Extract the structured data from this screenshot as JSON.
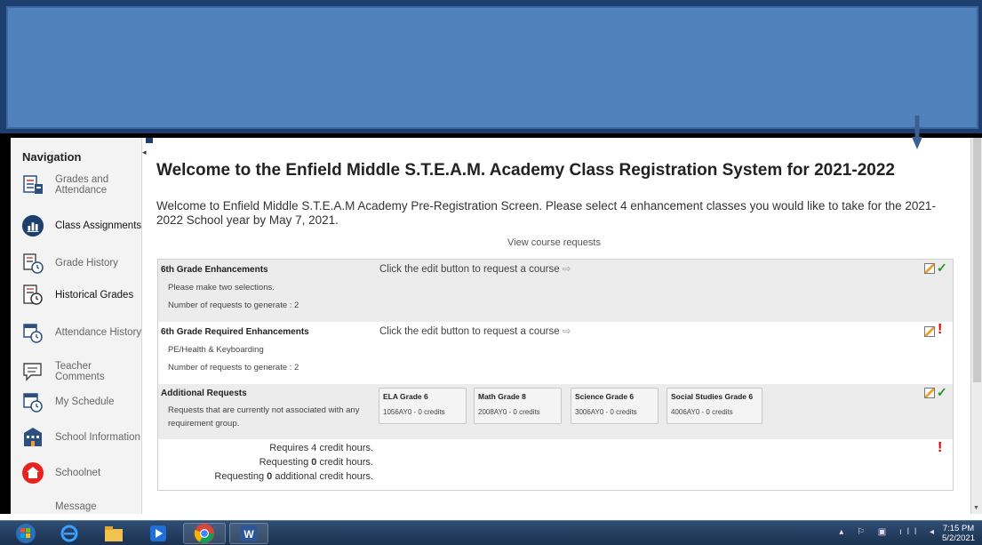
{
  "navigation": {
    "title": "Navigation",
    "items": [
      {
        "label": "Grades and Attendance",
        "icon": "grades-icon"
      },
      {
        "label": "Class Assignments",
        "icon": "bar-chart-icon"
      },
      {
        "label": "Grade History",
        "icon": "grade-history-icon"
      },
      {
        "label": "Historical Grades",
        "icon": "historical-grades-icon"
      },
      {
        "label": "Attendance History",
        "icon": "attendance-history-icon"
      },
      {
        "label": "Teacher Comments",
        "icon": "comments-icon"
      },
      {
        "label": "My Schedule",
        "icon": "schedule-icon"
      },
      {
        "label": "School Information",
        "icon": "school-icon"
      },
      {
        "label": "Schoolnet",
        "icon": "schoolnet-icon"
      },
      {
        "label": "Message",
        "icon": ""
      }
    ]
  },
  "main": {
    "title": "Welcome to the Enfield Middle S.T.E.A.M. Academy Class Registration System for 2021-2022",
    "intro": "Welcome to Enfield Middle S.T.E.A.M Academy Pre-Registration Screen. Please select 4 enhancement classes you would like to take for the 2021-2022 School year by May 7, 2021.",
    "view_requests": "View course requests"
  },
  "requests": {
    "hint": "Click the edit button to request a course",
    "groups": [
      {
        "title": "6th Grade Enhancements",
        "line1": "Please make two selections.",
        "line2": "Number of requests to generate : 2"
      },
      {
        "title": "6th Grade Required Enhancements",
        "line1": "PE/Health & Keyboarding",
        "line2": "Number of requests to generate : 2"
      }
    ],
    "additional": {
      "title": "Additional Requests",
      "description": "Requests that are currently not associated with any requirement group.",
      "courses": [
        {
          "name": "ELA Grade 6",
          "code": "1056AY0 - 0 credits"
        },
        {
          "name": "Math Grade 8",
          "code": "2008AY0 - 0 credits"
        },
        {
          "name": "Science Grade 6",
          "code": "3006AY0 - 0 credits"
        },
        {
          "name": "Social Studies Grade 6",
          "code": "4006AY0 - 0 credits"
        }
      ]
    },
    "credits": {
      "requires": "Requires 4 credit hours.",
      "req_prefix": "Requesting ",
      "req_value": "0",
      "req_suffix": " credit hours.",
      "add_prefix": "Requesting ",
      "add_value": "0",
      "add_suffix": " additional credit hours."
    }
  },
  "taskbar": {
    "time": "7:15 PM",
    "date": "5/2/2021"
  },
  "colors": {
    "banner": "#4f81bd",
    "check": "#1f9a1f",
    "warning": "#e00000",
    "annotation_arrow": "#3d5f8f"
  }
}
